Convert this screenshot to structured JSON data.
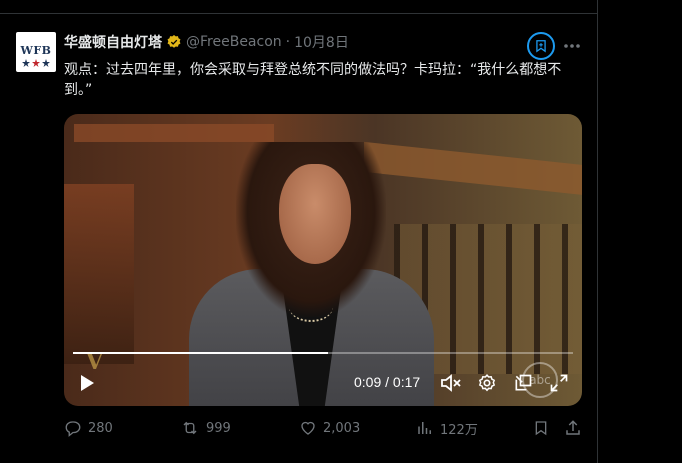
{
  "tweet": {
    "author": {
      "display_name": "华盛顿自由灯塔",
      "handle": "@FreeBeacon",
      "avatar_text": "WFB"
    },
    "separator": "·",
    "date": "10月8日",
    "text": "观点：过去四年里，你会采取与拜登总统不同的做法吗？卡玛拉：“我什么都想不到。”"
  },
  "video": {
    "current_time": "0:09",
    "duration": "0:17",
    "time_display": "0:09 / 0:17",
    "progress": 0.51,
    "show_logo_text": "V",
    "network_logo_text": "abc"
  },
  "actions": {
    "replies": "280",
    "reposts": "999",
    "likes": "2,003",
    "views": "122万"
  },
  "colors": {
    "accent": "#1d9bf0",
    "verified": "#e2b719",
    "muted": "#71767b"
  },
  "icons": [
    "verified-badge-icon",
    "bookmark-icon",
    "more-icon",
    "play-icon",
    "mute-icon",
    "settings-icon",
    "popout-icon",
    "fullscreen-icon",
    "reply-icon",
    "repost-icon",
    "like-icon",
    "views-icon",
    "share-icon"
  ]
}
